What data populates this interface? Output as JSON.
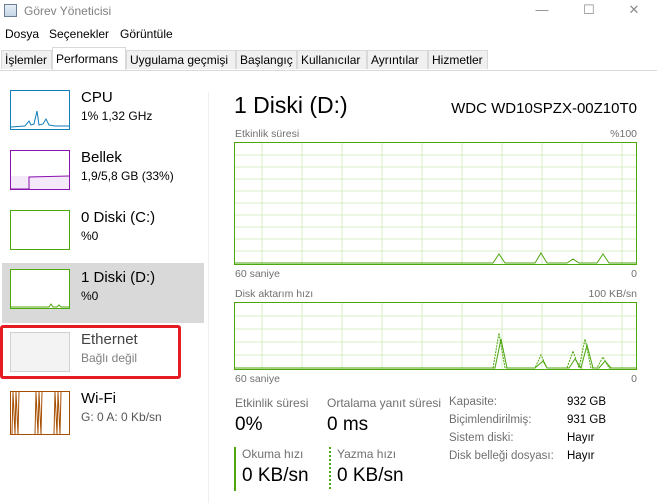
{
  "window": {
    "title": "Görev Yöneticisi",
    "minimize_glyph": "—",
    "maximize_glyph": "☐",
    "close_glyph": "✕"
  },
  "menu": [
    "Dosya",
    "Seçenekler",
    "Görüntüle"
  ],
  "tabs": [
    "İşlemler",
    "Performans",
    "Uygulama geçmişi",
    "Başlangıç",
    "Kullanıcılar",
    "Ayrıntılar",
    "Hizmetler"
  ],
  "active_tab": "Performans",
  "sidebar": [
    {
      "name": "CPU",
      "sub": "1% 1,32 GHz",
      "color": "#117dbb"
    },
    {
      "name": "Bellek",
      "sub": "1,9/5,8 GB (33%)",
      "color": "#8b12ae"
    },
    {
      "name": "0 Diski (C:)",
      "sub": "%0",
      "color": "#4da60c"
    },
    {
      "name": "1 Diski (D:)",
      "sub": "%0",
      "color": "#4da60c"
    },
    {
      "name": "Ethernet",
      "sub": "Bağlı değil",
      "color": "#bdbdbd"
    },
    {
      "name": "Wi-Fi",
      "sub": "G: 0 A: 0 Kb/sn",
      "color": "#a74f01"
    }
  ],
  "main": {
    "title": "1 Diski (D:)",
    "model": "WDC WD10SPZX-00Z10T0",
    "graph1": {
      "label": "Etkinlik süresi",
      "max": "%100",
      "time": "60 saniye",
      "min": "0"
    },
    "graph2": {
      "label": "Disk aktarım hızı",
      "max": "100 KB/sn",
      "time": "60 saniye",
      "min": "0"
    },
    "stats": {
      "activity_label": "Etkinlik süresi",
      "activity_value": "0%",
      "response_label": "Ortalama yanıt süresi",
      "response_value": "0 ms",
      "read_label": "Okuma hızı",
      "read_value": "0 KB/sn",
      "write_label": "Yazma hızı",
      "write_value": "0 KB/sn"
    },
    "props": [
      {
        "key": "Kapasite:",
        "value": "932 GB"
      },
      {
        "key": "Biçimlendirilmiş:",
        "value": "931 GB"
      },
      {
        "key": "Sistem diski:",
        "value": "Hayır"
      },
      {
        "key": "Disk belleği dosyası:",
        "value": "Hayır"
      }
    ]
  }
}
